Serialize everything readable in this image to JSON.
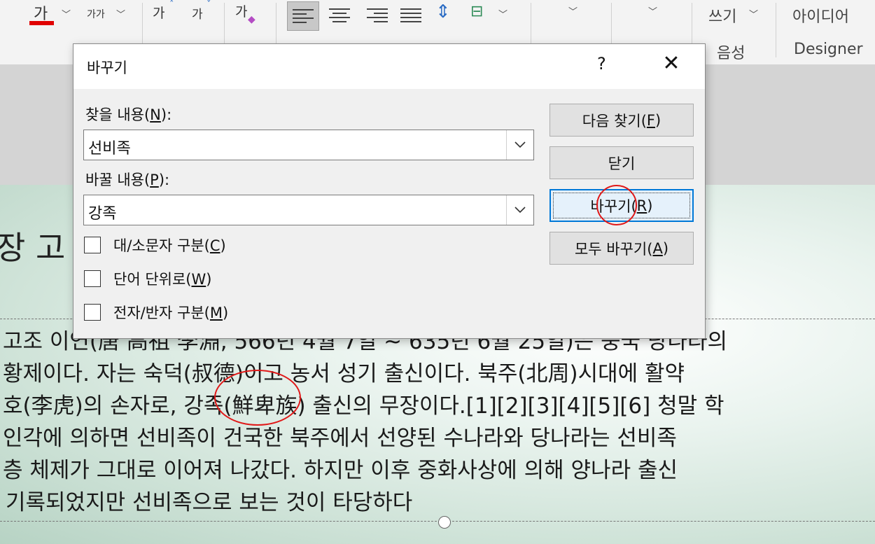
{
  "ribbon": {
    "font_color_glyph": "가",
    "font_size_glyph": "가가",
    "grow_font_glyph": "가",
    "shrink_font_glyph": "가",
    "clear_format_glyph": "가",
    "write_label": "쓰기",
    "voice_group_label": "음성",
    "ideas_label": "아이디어",
    "designer_label": "Designer",
    "font_color_accent": "#e00000"
  },
  "dialog": {
    "title": "바꾸기",
    "help": "?",
    "close": "✕",
    "find_label_pre": "찾을 내용(",
    "find_label_key": "N",
    "find_label_post": "):",
    "find_value": "선비족",
    "replace_label_pre": "바꿀 내용(",
    "replace_label_key": "P",
    "replace_label_post": "):",
    "replace_value": "강족",
    "options": [
      {
        "pre": "대/소문자 구분(",
        "key": "C",
        "post": ")",
        "checked": false
      },
      {
        "pre": "단어 단위로(",
        "key": "W",
        "post": ")",
        "checked": false
      },
      {
        "pre": "전자/반자 구분(",
        "key": "M",
        "post": ")",
        "checked": false
      }
    ],
    "buttons": {
      "find_next": {
        "pre": "다음 찾기(",
        "key": "F",
        "post": ")"
      },
      "close": "닫기",
      "replace": {
        "pre": "바꾸기(",
        "key": "R",
        "post": ")"
      },
      "replace_all": {
        "pre": "모두 바꾸기(",
        "key": "A",
        "post": ")"
      }
    }
  },
  "slide": {
    "title_fragment": "장 고",
    "lines": [
      "고조 이연(唐 高祖 李淵, 566년 4월 7일 ~ 635년 6월 25일)은 중국 당나라의",
      "황제이다. 자는 숙덕(叔德)이고 농서 성기 출신이다. 북주(北周)시대에 활약",
      "호(李虎)의 손자로, 강족(鮮卑族) 출신의 무장이다.[1][2][3][4][5][6] 청말 학",
      "인각에 의하면 선비족이 건국한 북주에서 선양된 수나라와 당나라는 선비족",
      "층 체제가 그대로 이어져 나갔다. 하지만 이후 중화사상에 의해 양나라 출신",
      "기록되었지만 선비족으로 보는 것이 타당하다"
    ],
    "annotation_color": "#e01818"
  }
}
